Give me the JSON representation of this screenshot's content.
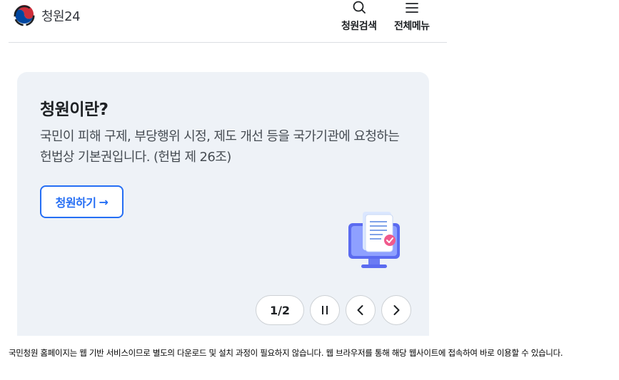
{
  "header": {
    "logo_text": "청원24",
    "search_label": "청원검색",
    "menu_label": "전체메뉴"
  },
  "card": {
    "title": "청원이란?",
    "description_line1": "국민이 피해 구제, 부당행위 시정, 제도 개선 등을 국가기관에 요청하는",
    "description_line2": "헌법상 기본권입니다. (헌법 제 26조)",
    "button_label": "청원하기",
    "button_arrow": "→"
  },
  "carousel": {
    "page_indicator": "1/2",
    "pause_icon": "pause-icon",
    "prev_icon": "chevron-left-icon",
    "next_icon": "chevron-right-icon"
  },
  "footnote": "국민청원 홈페이지는 웹 기반 서비스이므로 별도의 다운로드 및 설치 과정이 필요하지 않습니다. 웹 브라우저를 통해 해당 웹사이트에 접속하여 바로 이용할 수 있습니다.",
  "colors": {
    "accent": "#256ef4",
    "card_bg": "#eef2f7",
    "logo_red": "#cd2e3a",
    "logo_blue": "#0047a0"
  }
}
